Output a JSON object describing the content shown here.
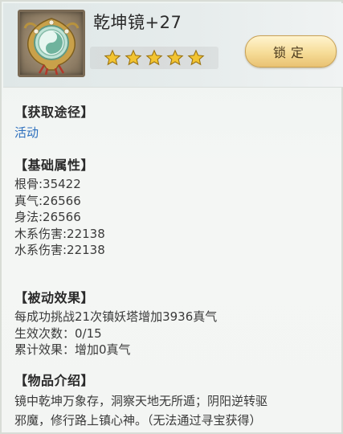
{
  "item": {
    "name": "乾坤镜+27",
    "stars": 5,
    "lock_label": "锁定"
  },
  "acquire": {
    "heading": "【获取途径】",
    "source": "活动"
  },
  "base_attrs": {
    "heading": "【基础属性】",
    "lines": [
      "根骨:35422",
      "真气:26566",
      "身法:26566",
      "木系伤害:22138",
      "水系伤害:22138"
    ]
  },
  "passive": {
    "heading": "【被动效果】",
    "lines": [
      "每成功挑战21次镇妖塔增加3936真气",
      "生效次数：0/15",
      "累计效果：增加0真气"
    ]
  },
  "intro": {
    "heading": "【物品介绍】",
    "lines": [
      "镜中乾坤万象存，洞察天地无所遁；阴阳逆转驱",
      "邪魔，修行路上镇心神。（无法通过寻宝获得）"
    ]
  },
  "colors": {
    "link": "#2d6fbd",
    "star": "#f3c431",
    "lock_button": "#f6dc97"
  }
}
